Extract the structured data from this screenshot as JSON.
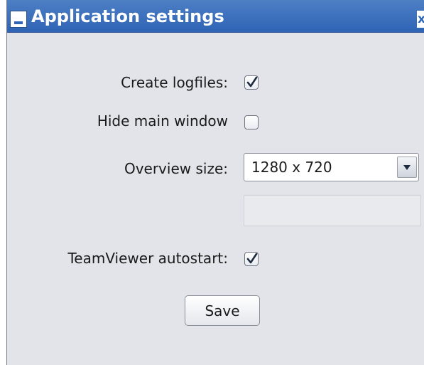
{
  "window": {
    "title": "Application settings",
    "close_label": "x"
  },
  "settings": {
    "create_logfiles": {
      "label": "Create logfiles:",
      "checked": true
    },
    "hide_main_window": {
      "label": "Hide main window",
      "checked": false
    },
    "overview_size": {
      "label": "Overview size:",
      "selected": "1280 x 720"
    },
    "extra_field": {
      "value": ""
    },
    "teamviewer_autostart": {
      "label": "TeamViewer autostart:",
      "checked": true
    }
  },
  "actions": {
    "save_label": "Save"
  },
  "colors": {
    "titlebar": "#2f64b6",
    "panel": "#e3e4e9"
  }
}
